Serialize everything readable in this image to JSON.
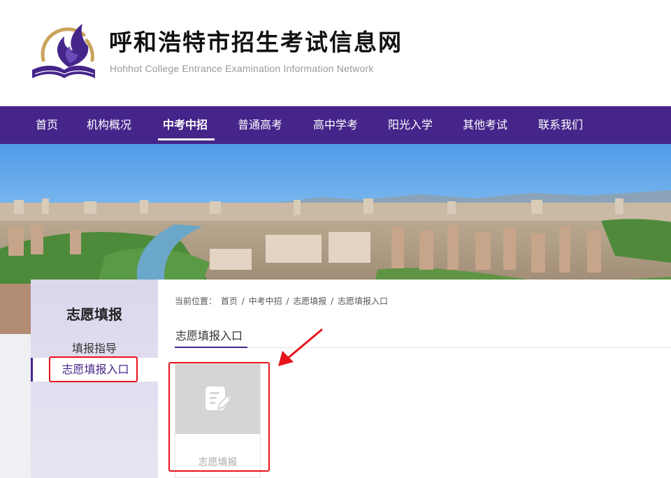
{
  "header": {
    "title": "呼和浩特市招生考试信息网",
    "subtitle": "Hohhot College Entrance Examination Information Network"
  },
  "nav": {
    "items": [
      {
        "label": "首页"
      },
      {
        "label": "机构概况"
      },
      {
        "label": "中考中招"
      },
      {
        "label": "普通高考"
      },
      {
        "label": "高中学考"
      },
      {
        "label": "阳光入学"
      },
      {
        "label": "其他考试"
      },
      {
        "label": "联系我们"
      }
    ],
    "active": "中考中招"
  },
  "sidebar": {
    "title": "志愿填报",
    "items": [
      {
        "label": "填报指导"
      },
      {
        "label": "志愿填报入口"
      }
    ]
  },
  "breadcrumb": {
    "prefix": "当前位置：",
    "items": [
      "首页",
      "中考中招",
      "志愿填报",
      "志愿填报入口"
    ],
    "separator": "/"
  },
  "section": {
    "title": "志愿填报入口"
  },
  "card": {
    "label": "志愿填报",
    "icon": "edit-document-icon"
  },
  "colors": {
    "brand_purple": "#45258a",
    "highlight_red": "#e8141c",
    "logo_gold": "#c9a45c"
  }
}
